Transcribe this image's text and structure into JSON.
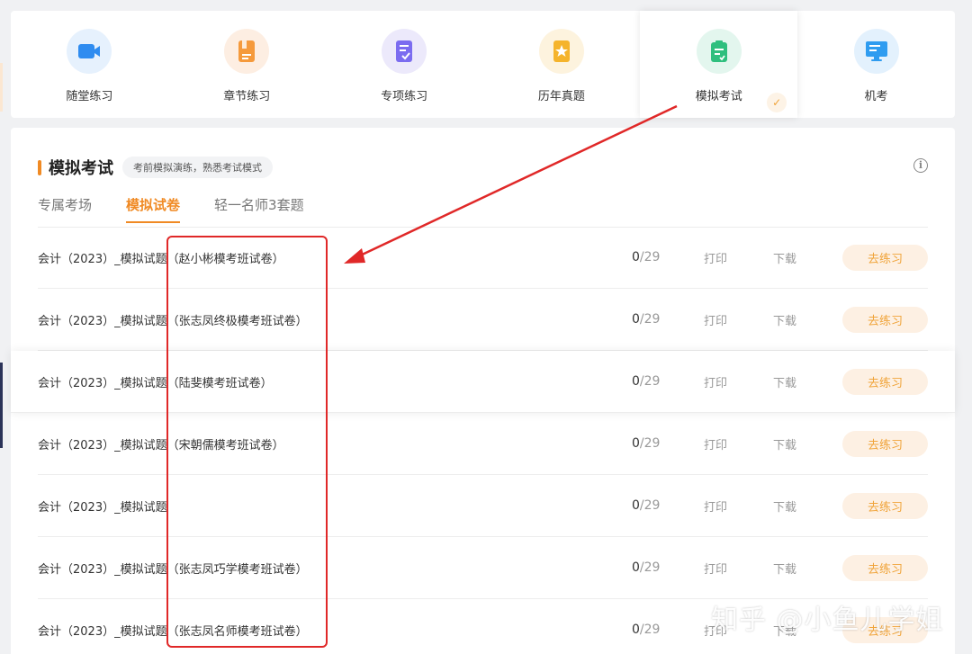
{
  "modes": [
    {
      "label": "随堂练习",
      "icon": "video-icon",
      "bg": "#e6f1fd",
      "color": "#2f8cf0"
    },
    {
      "label": "章节练习",
      "icon": "book-icon",
      "bg": "#fdeee2",
      "color": "#f59a3c"
    },
    {
      "label": "专项练习",
      "icon": "checklist-icon",
      "bg": "#ece9fb",
      "color": "#7b6cf0"
    },
    {
      "label": "历年真题",
      "icon": "star-book-icon",
      "bg": "#fdf3de",
      "color": "#f5b42c"
    },
    {
      "label": "模拟考试",
      "icon": "exam-icon",
      "bg": "#e3f6ee",
      "color": "#2fbf7e",
      "active": true
    },
    {
      "label": "机考",
      "icon": "monitor-icon",
      "bg": "#e3f1fd",
      "color": "#2f9cf0"
    }
  ],
  "section": {
    "title": "模拟考试",
    "tag": "考前模拟演练，熟悉考试模式"
  },
  "tabs": [
    {
      "label": "专属考场"
    },
    {
      "label": "模拟试卷",
      "active": true
    },
    {
      "label": "轻一名师3套题"
    }
  ],
  "actions": {
    "print": "打印",
    "download": "下载",
    "practice": "去练习"
  },
  "papers": [
    {
      "title": "会计（2023）_模拟试题（赵小彬模考班试卷）",
      "done": "0",
      "total": "/29"
    },
    {
      "title": "会计（2023）_模拟试题（张志凤终极模考班试卷）",
      "done": "0",
      "total": "/29"
    },
    {
      "title": "会计（2023）_模拟试题（陆斐模考班试卷）",
      "done": "0",
      "total": "/29",
      "highlight": true
    },
    {
      "title": "会计（2023）_模拟试题（宋朝儒模考班试卷）",
      "done": "0",
      "total": "/29"
    },
    {
      "title": "会计（2023）_模拟试题",
      "done": "0",
      "total": "/29"
    },
    {
      "title": "会计（2023）_模拟试题（张志凤巧学模考班试卷）",
      "done": "0",
      "total": "/29"
    },
    {
      "title": "会计（2023）_模拟试题（张志凤名师模考班试卷）",
      "done": "0",
      "total": "/29"
    }
  ],
  "watermark": "知乎 @小鱼儿学姐",
  "colors": {
    "accent": "#f08a24",
    "annotation": "#e02828"
  }
}
